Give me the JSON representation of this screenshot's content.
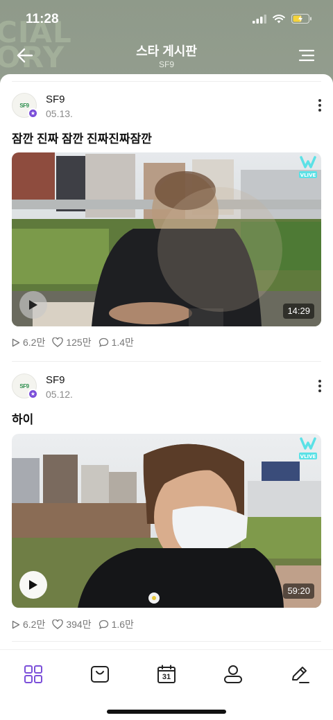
{
  "status": {
    "time": "11:28"
  },
  "header": {
    "title": "스타 게시판",
    "subtitle": "SF9",
    "bg_words": [
      "CIAL",
      "ORY"
    ]
  },
  "posts": [
    {
      "author": "SF9",
      "date": "05.13.",
      "title": "잠깐 진짜 잠깐 진짜진짜잠깐",
      "duration": "14:29",
      "plays": "6.2만",
      "likes": "125만",
      "comments": "1.4만",
      "avatar_text": "SF9"
    },
    {
      "author": "SF9",
      "date": "05.12.",
      "title": "하이",
      "duration": "59:20",
      "plays": "6.2만",
      "likes": "394만",
      "comments": "1.6만",
      "avatar_text": "SF9"
    }
  ],
  "tabbar": {
    "calendar_day": "31",
    "items": [
      "grid-icon",
      "shopping-bag-icon",
      "calendar-icon",
      "profile-icon",
      "pencil-icon"
    ],
    "active_color": "#7b4fd9"
  },
  "colors": {
    "accent": "#7b4fd9",
    "header_bg": "#939d8e"
  }
}
